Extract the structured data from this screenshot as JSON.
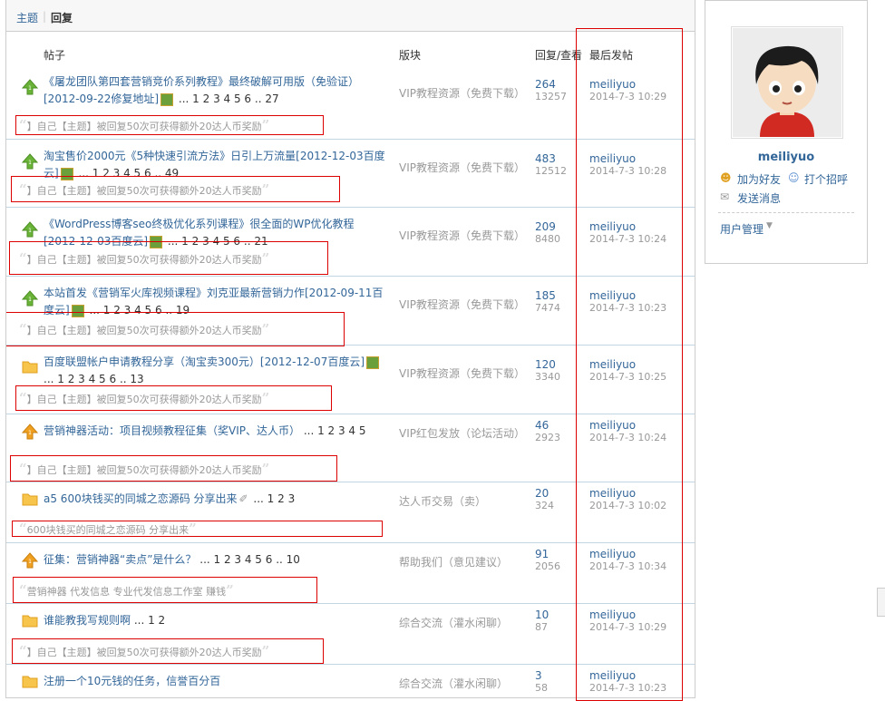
{
  "tabs": {
    "topics": "主题",
    "sep": "|",
    "replies": "回复"
  },
  "headers": {
    "post": "帖子",
    "forum": "版块",
    "replies_views": "回复/查看",
    "last_post": "最后发帖"
  },
  "rows": [
    {
      "title": "《屠龙团队第四套营销竞价系列教程》最终破解可用版（免验证）[2012-09-22修复地址]",
      "pages": "... 1 2 3 4 5 6 .. 27",
      "forum": "VIP教程资源（免费下载）",
      "replies": "264",
      "views": "13257",
      "user": "meiliyuo",
      "time": "2014-7-3 10:29",
      "quote": "】自己【主题】被回复50次可获得额外20达人币奖励",
      "icon": "up-green"
    },
    {
      "title": "淘宝售价2000元《5种快速引流方法》日引上万流量[2012-12-03百度云]",
      "pages": "... 1 2 3 4 5 6 .. 49",
      "forum": "VIP教程资源（免费下载）",
      "replies": "483",
      "views": "12512",
      "user": "meiliyuo",
      "time": "2014-7-3 10:28",
      "quote": "】自己【主题】被回复50次可获得额外20达人币奖励",
      "icon": "up-green"
    },
    {
      "title": "《WordPress博客seo终极优化系列课程》很全面的WP优化教程[2012-12-03百度云]",
      "pages": "... 1 2 3 4 5 6 .. 21",
      "forum": "VIP教程资源（免费下载）",
      "replies": "209",
      "views": "8480",
      "user": "meiliyuo",
      "time": "2014-7-3 10:24",
      "quote": "】自己【主题】被回复50次可获得额外20达人币奖励",
      "icon": "up-green"
    },
    {
      "title": "本站首发《营销军火库视频课程》刘克亚最新营销力作[2012-09-11百度云]",
      "pages": "... 1 2 3 4 5 6 .. 19",
      "forum": "VIP教程资源（免费下载）",
      "replies": "185",
      "views": "7474",
      "user": "meiliyuo",
      "time": "2014-7-3 10:23",
      "quote": "】自己【主题】被回复50次可获得额外20达人币奖励",
      "icon": "up-green"
    },
    {
      "title": "百度联盟帐户申请教程分享（淘宝卖300元）[2012-12-07百度云]",
      "pages": "... 1 2 3 4 5 6 .. 13",
      "forum": "VIP教程资源（免费下载）",
      "replies": "120",
      "views": "3340",
      "user": "meiliyuo",
      "time": "2014-7-3 10:25",
      "quote": "】自己【主题】被回复50次可获得额外20达人币奖励",
      "icon": "folder"
    },
    {
      "title": "营销神器活动：项目视频教程征集（奖VIP、达人币）",
      "pages": "... 1 2 3 4 5",
      "forum": "VIP红包发放（论坛活动）",
      "replies": "46",
      "views": "2923",
      "user": "meiliyuo",
      "time": "2014-7-3 10:24",
      "quote": "】自己【主题】被回复50次可获得额外20达人币奖励",
      "icon": "up-orange"
    },
    {
      "title": "a5 600块钱买的同城之恋源码 分享出来",
      "pages": "... 1 2 3",
      "forum": "达人币交易（卖）",
      "replies": "20",
      "views": "324",
      "user": "meiliyuo",
      "time": "2014-7-3 10:02",
      "quote": "600块钱买的同城之恋源码 分享出来",
      "icon": "folder"
    },
    {
      "title": "征集：营销神器“卖点”是什么？",
      "pages": "... 1 2 3 4 5 6 .. 10",
      "forum": "帮助我们（意见建议）",
      "replies": "91",
      "views": "2056",
      "user": "meiliyuo",
      "time": "2014-7-3 10:34",
      "quote": "营销神器 代发信息 专业代发信息工作室 赚钱",
      "icon": "up-orange"
    },
    {
      "title": "谁能教我写规则啊",
      "pages": "... 1 2",
      "forum": "综合交流（灌水闲聊）",
      "replies": "10",
      "views": "87",
      "user": "meiliyuo",
      "time": "2014-7-3 10:29",
      "quote": "】自己【主题】被回复50次可获得额外20达人币奖励",
      "icon": "folder"
    },
    {
      "title": "注册一个10元钱的任务，信誉百分百",
      "pages": "",
      "forum": "综合交流（灌水闲聊）",
      "replies": "3",
      "views": "58",
      "user": "meiliyuo",
      "time": "2014-7-3 10:23",
      "quote": "",
      "icon": "folder"
    }
  ],
  "sidebar": {
    "username": "meiliyuo",
    "add_friend": "加为好友",
    "greet": "打个招呼",
    "send_msg": "发送消息",
    "user_manage": "用户管理"
  }
}
